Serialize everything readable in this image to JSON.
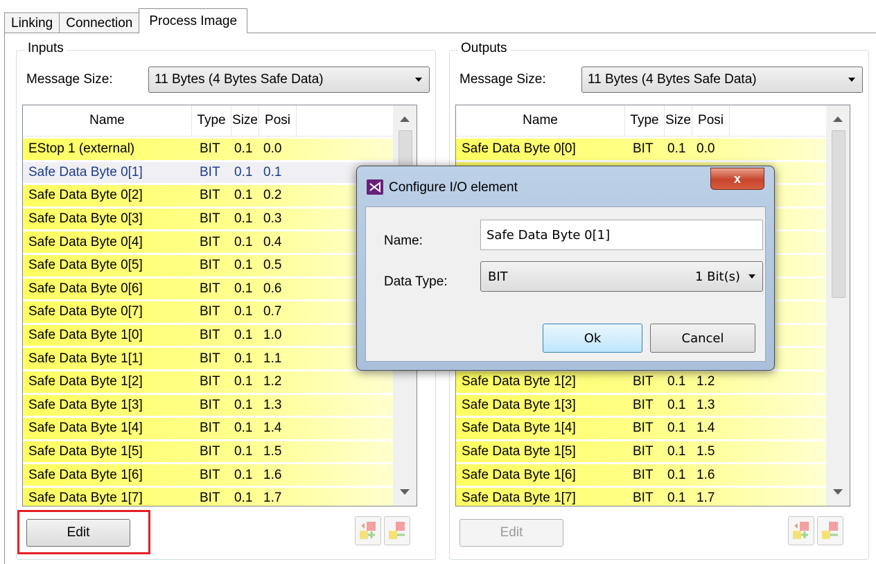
{
  "tabs": [
    "Linking",
    "Connection",
    "Process Image"
  ],
  "inputs": {
    "title": "Inputs",
    "message_size_label": "Message Size:",
    "message_size_value": "11 Bytes (4 Bytes Safe Data)",
    "columns": [
      "Name",
      "Type",
      "Size",
      "Posi"
    ],
    "rows": [
      {
        "name": "EStop 1 (external)",
        "type": "BIT",
        "size": "0.1",
        "pos": "0.0"
      },
      {
        "name": "Safe Data Byte 0[1]",
        "type": "BIT",
        "size": "0.1",
        "pos": "0.1"
      },
      {
        "name": "Safe Data Byte 0[2]",
        "type": "BIT",
        "size": "0.1",
        "pos": "0.2"
      },
      {
        "name": "Safe Data Byte 0[3]",
        "type": "BIT",
        "size": "0.1",
        "pos": "0.3"
      },
      {
        "name": "Safe Data Byte 0[4]",
        "type": "BIT",
        "size": "0.1",
        "pos": "0.4"
      },
      {
        "name": "Safe Data Byte 0[5]",
        "type": "BIT",
        "size": "0.1",
        "pos": "0.5"
      },
      {
        "name": "Safe Data Byte 0[6]",
        "type": "BIT",
        "size": "0.1",
        "pos": "0.6"
      },
      {
        "name": "Safe Data Byte 0[7]",
        "type": "BIT",
        "size": "0.1",
        "pos": "0.7"
      },
      {
        "name": "Safe Data Byte 1[0]",
        "type": "BIT",
        "size": "0.1",
        "pos": "1.0"
      },
      {
        "name": "Safe Data Byte 1[1]",
        "type": "BIT",
        "size": "0.1",
        "pos": "1.1"
      },
      {
        "name": "Safe Data Byte 1[2]",
        "type": "BIT",
        "size": "0.1",
        "pos": "1.2"
      },
      {
        "name": "Safe Data Byte 1[3]",
        "type": "BIT",
        "size": "0.1",
        "pos": "1.3"
      },
      {
        "name": "Safe Data Byte 1[4]",
        "type": "BIT",
        "size": "0.1",
        "pos": "1.4"
      },
      {
        "name": "Safe Data Byte 1[5]",
        "type": "BIT",
        "size": "0.1",
        "pos": "1.5"
      },
      {
        "name": "Safe Data Byte 1[6]",
        "type": "BIT",
        "size": "0.1",
        "pos": "1.6"
      },
      {
        "name": "Safe Data Byte 1[7]",
        "type": "BIT",
        "size": "0.1",
        "pos": "1.7"
      }
    ],
    "selected_row": 1,
    "edit_label": "Edit"
  },
  "outputs": {
    "title": "Outputs",
    "message_size_label": "Message Size:",
    "message_size_value": "11 Bytes (4 Bytes Safe Data)",
    "columns": [
      "Name",
      "Type",
      "Size",
      "Posi"
    ],
    "rows": [
      {
        "name": "Safe Data Byte 0[0]",
        "type": "BIT",
        "size": "0.1",
        "pos": "0.0"
      },
      {
        "name": "",
        "type": "",
        "size": "",
        "pos": ""
      },
      {
        "name": "",
        "type": "",
        "size": "",
        "pos": ""
      },
      {
        "name": "",
        "type": "",
        "size": "",
        "pos": ""
      },
      {
        "name": "",
        "type": "",
        "size": "",
        "pos": ""
      },
      {
        "name": "",
        "type": "",
        "size": "",
        "pos": ""
      },
      {
        "name": "",
        "type": "",
        "size": "",
        "pos": ""
      },
      {
        "name": "",
        "type": "",
        "size": "",
        "pos": ""
      },
      {
        "name": "",
        "type": "",
        "size": "",
        "pos": ""
      },
      {
        "name": "",
        "type": "",
        "size": "",
        "pos": ""
      },
      {
        "name": "Safe Data Byte 1[2]",
        "type": "BIT",
        "size": "0.1",
        "pos": "1.2"
      },
      {
        "name": "Safe Data Byte 1[3]",
        "type": "BIT",
        "size": "0.1",
        "pos": "1.3"
      },
      {
        "name": "Safe Data Byte 1[4]",
        "type": "BIT",
        "size": "0.1",
        "pos": "1.4"
      },
      {
        "name": "Safe Data Byte 1[5]",
        "type": "BIT",
        "size": "0.1",
        "pos": "1.5"
      },
      {
        "name": "Safe Data Byte 1[6]",
        "type": "BIT",
        "size": "0.1",
        "pos": "1.6"
      },
      {
        "name": "Safe Data Byte 1[7]",
        "type": "BIT",
        "size": "0.1",
        "pos": "1.7"
      }
    ],
    "edit_label": "Edit"
  },
  "dialog": {
    "title": "Configure I/O element",
    "close_label": "x",
    "name_label": "Name:",
    "name_value": "Safe Data Byte 0[1]",
    "type_label": "Data Type:",
    "type_value": "BIT",
    "type_units": "1 Bit(s)",
    "ok_label": "Ok",
    "cancel_label": "Cancel"
  },
  "colors": {
    "row_yellow": "#ffff60",
    "highlight_red": "#e51f24",
    "selected_text": "#1b3d8c"
  }
}
